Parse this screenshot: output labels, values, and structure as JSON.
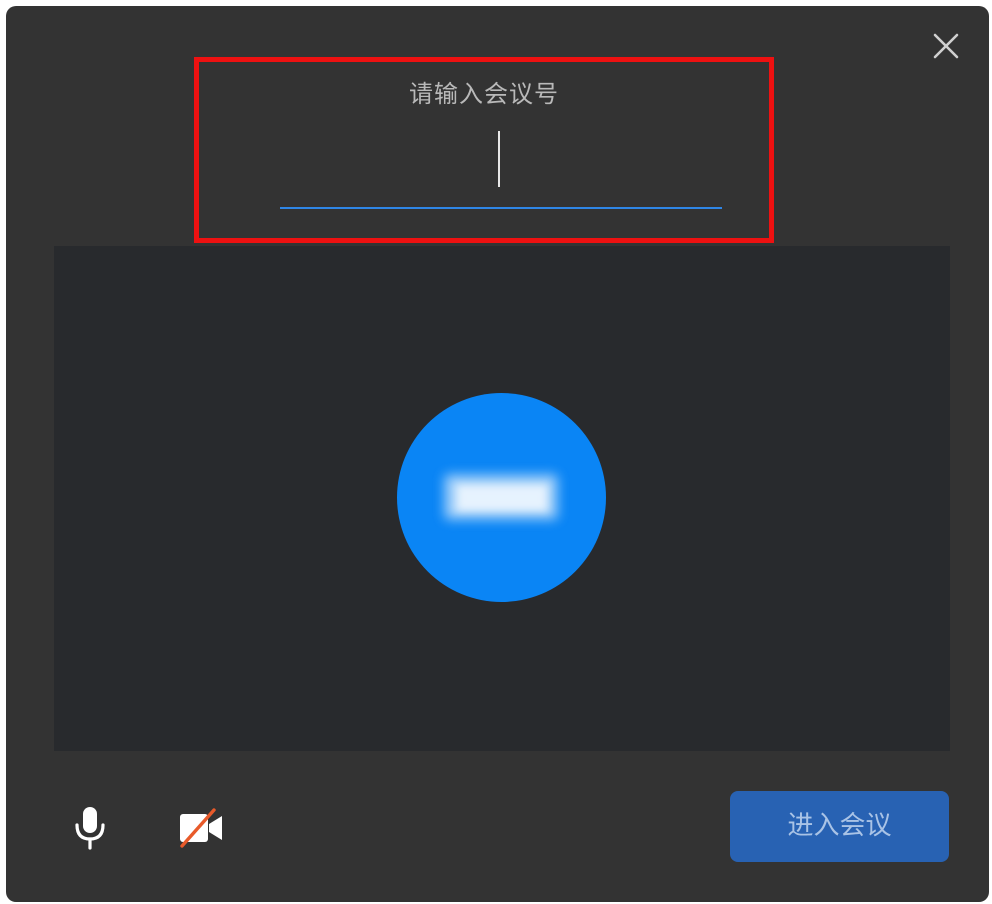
{
  "dialog": {
    "prompt": "请输入会议号",
    "meeting_number_value": "",
    "join_label": "进入会议"
  },
  "icons": {
    "close": "close-icon",
    "mic": "microphone-icon",
    "camera": "camera-off-icon"
  },
  "colors": {
    "background": "#333333",
    "preview": "#282a2d",
    "avatar": "#0a85f5",
    "accent": "#2f86e6",
    "join_button": "#2862b3",
    "highlight": "#ee1111"
  }
}
